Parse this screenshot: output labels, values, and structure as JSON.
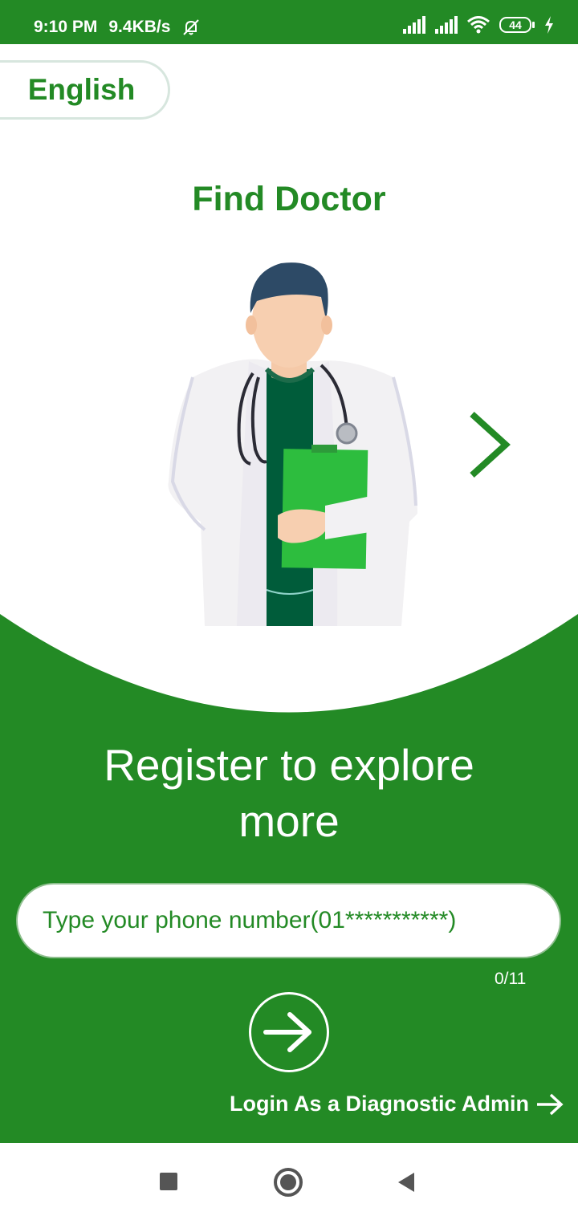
{
  "status_bar": {
    "time": "9:10 PM",
    "speed": "9.4KB/s",
    "battery": "44",
    "icons": [
      "mute-bell-icon",
      "signal-icon",
      "signal-icon",
      "wifi-icon",
      "battery-icon",
      "charging-icon"
    ]
  },
  "language": {
    "label": "English"
  },
  "onboarding": {
    "title": "Find Doctor",
    "image": "doctor-illustration",
    "next_icon": "chevron-right-icon"
  },
  "register": {
    "heading": "Register to explore more",
    "phone_placeholder": "Type your phone number(01***********)",
    "phone_value": "",
    "counter": "0/11",
    "submit_icon": "arrow-right-icon"
  },
  "admin_login": {
    "label": "Login As a Diagnostic Admin"
  },
  "nav_bar": {
    "icons": [
      "recents-icon",
      "home-icon",
      "back-icon"
    ]
  },
  "colors": {
    "brand_green": "#238a25",
    "accent_green": "#2dbd3e",
    "white": "#ffffff"
  }
}
